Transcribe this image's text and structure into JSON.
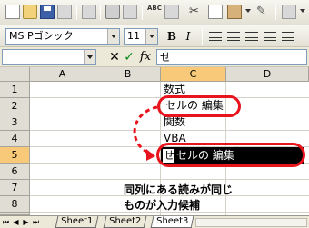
{
  "toolbar": {
    "icons": [
      "new-document-icon",
      "open-folder-icon",
      "save-icon",
      "permission-icon",
      "email-icon",
      "print-icon",
      "print-preview-icon",
      "spelling-icon",
      "research-icon",
      "cut-icon",
      "copy-icon",
      "paste-icon",
      "format-painter-icon"
    ],
    "spelling_glyph": "ABC"
  },
  "format_bar": {
    "font_name": "MS Pゴシック",
    "font_size": "11",
    "bold_glyph": "B",
    "italic_glyph": "I"
  },
  "formula_bar": {
    "cancel_glyph": "✕",
    "enter_glyph": "✓",
    "fx_label": "fx",
    "content": "せ"
  },
  "grid": {
    "columns": [
      "A",
      "B",
      "C",
      "D"
    ],
    "active_column": "C",
    "rows": [
      "1",
      "2",
      "3",
      "4",
      "5",
      "6",
      "7",
      "8",
      "9"
    ],
    "active_row": "5",
    "cells": {
      "C1": "数式",
      "C2": "セルの 編集",
      "C3": "関数",
      "C4": "VBA",
      "C5_typed": "せ",
      "C5_suggestion": "セルの 編集"
    }
  },
  "annotation": {
    "line1": "同列にある読みが同じ",
    "line2": "ものが入力候補",
    "accent_color": "#e8141d"
  },
  "sheet_tabs": {
    "tabs": [
      "Sheet1",
      "Sheet2",
      "Sheet3"
    ],
    "active": "Sheet3"
  }
}
